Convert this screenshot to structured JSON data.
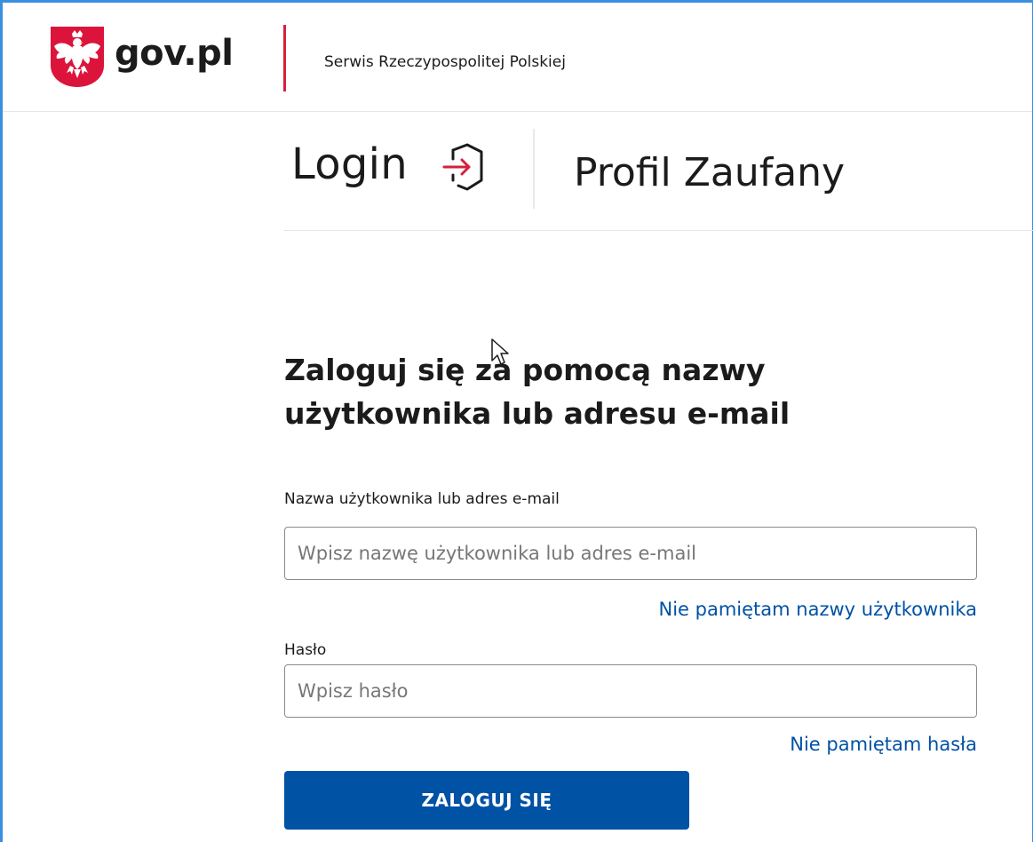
{
  "header": {
    "brand": "gov.pl",
    "service_name": "Serwis Rzeczypospolitej Polskiej"
  },
  "product": {
    "login_word": "Login",
    "product_name": "Profil Zaufany"
  },
  "form": {
    "heading": "Zaloguj się za pomocą nazwy użytkownika lub adresu e-mail",
    "username_label": "Nazwa użytkownika lub adres e-mail",
    "username_placeholder": "Wpisz nazwę użytkownika lub adres e-mail",
    "username_value": "",
    "forgot_username_link": "Nie pamiętam nazwy użytkownika",
    "password_label": "Hasło",
    "password_placeholder": "Wpisz hasło",
    "password_value": "",
    "forgot_password_link": "Nie pamiętam hasła",
    "submit_label": "ZALOGUJ SIĘ"
  },
  "icons": {
    "emblem": "polish-eagle-emblem-icon",
    "login": "login-arrow-icon",
    "cursor": "mouse-pointer-icon"
  },
  "colors": {
    "accent_red": "#d4213d",
    "primary_blue": "#0052a5",
    "emblem_red": "#dc143c",
    "window_border": "#3a8fe0"
  }
}
